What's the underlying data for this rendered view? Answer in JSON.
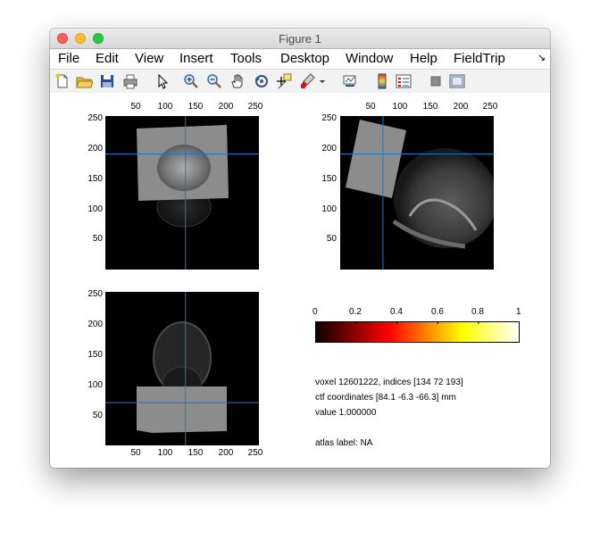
{
  "window": {
    "title": "Figure 1"
  },
  "menu": [
    "File",
    "Edit",
    "View",
    "Insert",
    "Tools",
    "Desktop",
    "Window",
    "Help",
    "FieldTrip"
  ],
  "toolbar": [
    {
      "name": "new-figure-icon",
      "icon": "new-figure"
    },
    {
      "name": "open-file-icon",
      "icon": "open-folder"
    },
    {
      "name": "save-icon",
      "icon": "floppy-disk"
    },
    {
      "name": "print-icon",
      "icon": "printer"
    },
    {
      "name": "pointer-icon",
      "icon": "arrow-pointer"
    },
    {
      "name": "zoom-in-icon",
      "icon": "magnifier-plus"
    },
    {
      "name": "zoom-out-icon",
      "icon": "magnifier-minus"
    },
    {
      "name": "pan-icon",
      "icon": "hand"
    },
    {
      "name": "rotate-3d-icon",
      "icon": "rotate"
    },
    {
      "name": "data-cursor-icon",
      "icon": "data-cursor"
    },
    {
      "name": "brush-icon",
      "icon": "brush"
    },
    {
      "name": "brush-dropdown-icon",
      "icon": "chevron-down"
    },
    {
      "name": "link-plot-icon",
      "icon": "link"
    },
    {
      "name": "insert-colorbar-icon",
      "icon": "colorbar"
    },
    {
      "name": "insert-legend-icon",
      "icon": "legend"
    },
    {
      "name": "hide-plot-tools-icon",
      "icon": "square"
    },
    {
      "name": "show-plot-tools-icon",
      "icon": "window-panes"
    }
  ],
  "axes": {
    "tick_labels": [
      "50",
      "100",
      "150",
      "200",
      "250"
    ],
    "colorbar_ticks": [
      "0",
      "0.2",
      "0.4",
      "0.6",
      "0.8",
      "1"
    ]
  },
  "chart_data": [
    {
      "type": "heatmap",
      "view": "axial",
      "x_ticks": [
        50,
        100,
        150,
        200,
        250
      ],
      "y_ticks": [
        50,
        100,
        150,
        200,
        250
      ],
      "xlim": [
        1,
        256
      ],
      "ylim": [
        1,
        256
      ],
      "crosshair": {
        "x": 134,
        "y": 193
      }
    },
    {
      "type": "heatmap",
      "view": "sagittal",
      "x_ticks": [
        50,
        100,
        150,
        200,
        250
      ],
      "y_ticks": [
        50,
        100,
        150,
        200,
        250
      ],
      "xlim": [
        1,
        256
      ],
      "ylim": [
        1,
        256
      ],
      "crosshair": {
        "x": 72,
        "y": 193
      }
    },
    {
      "type": "heatmap",
      "view": "coronal",
      "x_ticks": [
        50,
        100,
        150,
        200,
        250
      ],
      "y_ticks": [
        50,
        100,
        150,
        200,
        250
      ],
      "xlim": [
        1,
        256
      ],
      "ylim": [
        1,
        256
      ],
      "crosshair": {
        "x": 134,
        "y": 72
      }
    },
    {
      "type": "colorbar",
      "colormap": "hot",
      "range": [
        0,
        1
      ],
      "ticks": [
        0,
        0.2,
        0.4,
        0.6,
        0.8,
        1
      ]
    }
  ],
  "info": {
    "voxel": "voxel 12601222, indices [134 72 193]",
    "coords": "ctf coordinates [84.1 -6.3 -66.3] mm",
    "value": "value 1.000000",
    "atlas": "atlas label: NA"
  },
  "colors": {
    "crosshair": "#1f77c4",
    "overlay": "#8c8c8c",
    "background": "#000000"
  }
}
